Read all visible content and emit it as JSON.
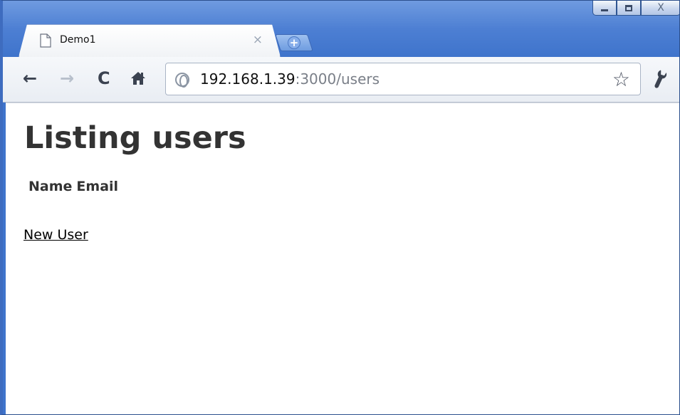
{
  "browser": {
    "tab": {
      "title": "Demo1",
      "close_glyph": "×"
    },
    "new_tab_glyph": "+",
    "window_controls": {
      "close_glyph": "X"
    },
    "address_bar": {
      "url_host": "192.168.1.39",
      "url_path": ":3000/users"
    },
    "icons": {
      "back": "←",
      "forward": "→",
      "reload": "C",
      "home": "⌂",
      "star": "☆",
      "wrench": "🔧"
    }
  },
  "page": {
    "title": "Listing users",
    "table": {
      "headers": [
        "Name",
        "Email"
      ]
    },
    "new_user_link": "New User"
  }
}
